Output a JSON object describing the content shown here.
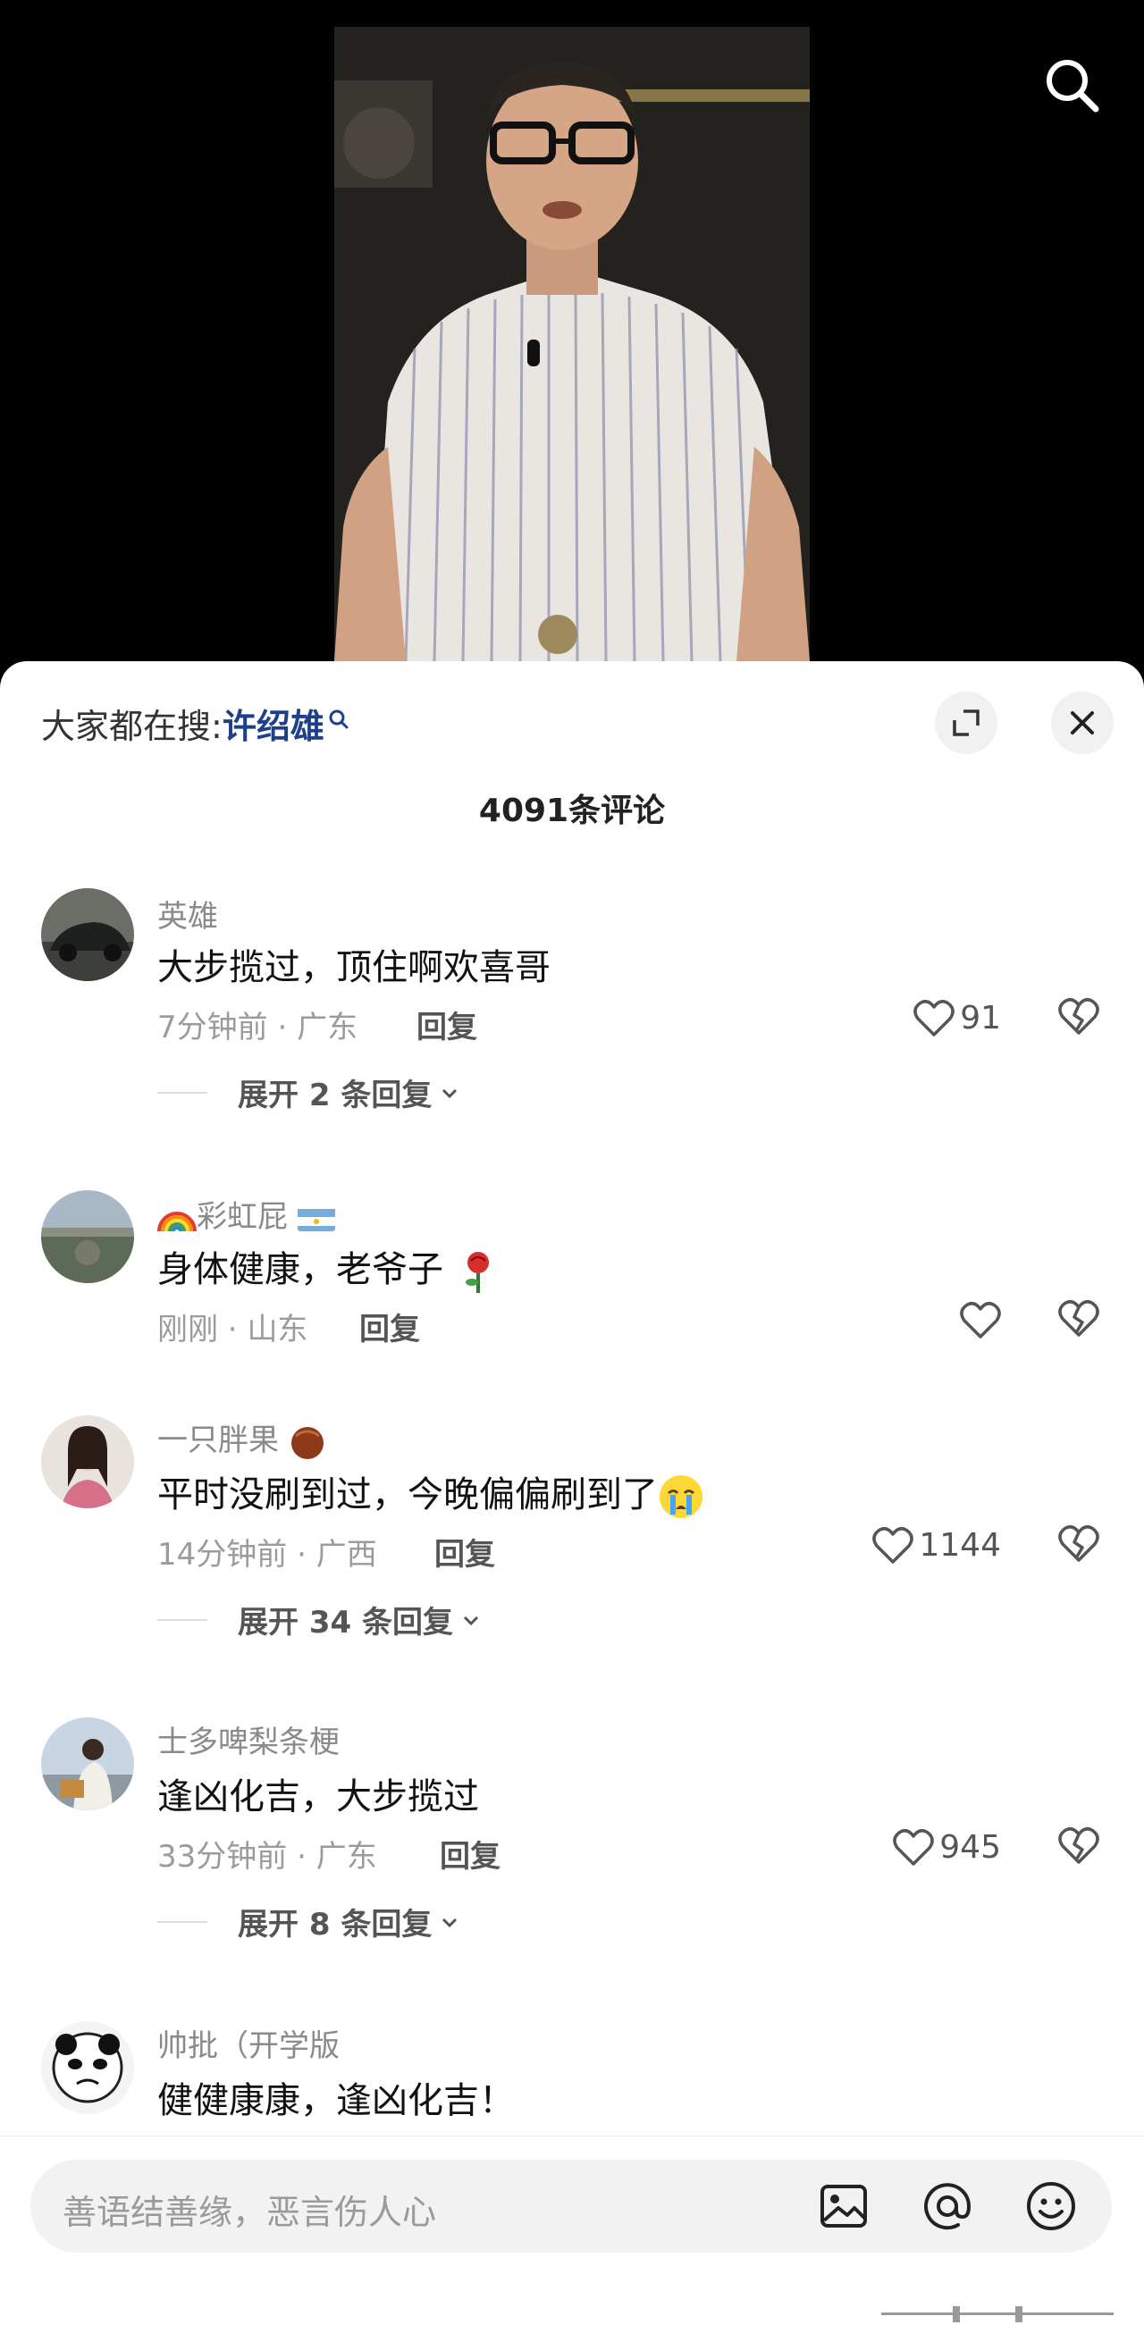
{
  "hot_search": {
    "prefix": "大家都在搜:",
    "keyword": "许绍雄"
  },
  "comment_count": "4091条评论",
  "comments": [
    {
      "user": "英雄",
      "text": "大步揽过，顶住啊欢喜哥",
      "time": "7分钟前",
      "location": "广东",
      "reply_label": "回复",
      "likes": "91",
      "expand": "展开 2 条回复"
    },
    {
      "user": "彩虹屁",
      "text": "身体健康，老爷子",
      "time": "刚刚",
      "location": "山东",
      "reply_label": "回复",
      "likes": "",
      "expand": ""
    },
    {
      "user": "一只胖果",
      "text": "平时没刷到过，今晚偏偏刷到了",
      "time": "14分钟前",
      "location": "广西",
      "reply_label": "回复",
      "likes": "1144",
      "expand": "展开 34 条回复"
    },
    {
      "user": "士多啤梨条梗",
      "text": "逢凶化吉，大步揽过",
      "time": "33分钟前",
      "location": "广东",
      "reply_label": "回复",
      "likes": "945",
      "expand": "展开 8 条回复"
    },
    {
      "user": "帅批（开学版",
      "text": "健健康康，逢凶化吉！",
      "time": "",
      "location": "",
      "reply_label": "",
      "likes": "",
      "expand": ""
    }
  ],
  "input": {
    "placeholder": "善语结善缘，恶言伤人心"
  },
  "icons": {
    "search": "search-icon",
    "expand": "expand-icon",
    "close": "close-icon",
    "like": "heart-icon",
    "dislike": "broken-heart-icon",
    "image": "image-icon",
    "mention": "at-icon",
    "emoji": "emoji-icon"
  },
  "colors": {
    "keyword": "#1f3f8a",
    "meta": "#9b9b9b"
  }
}
